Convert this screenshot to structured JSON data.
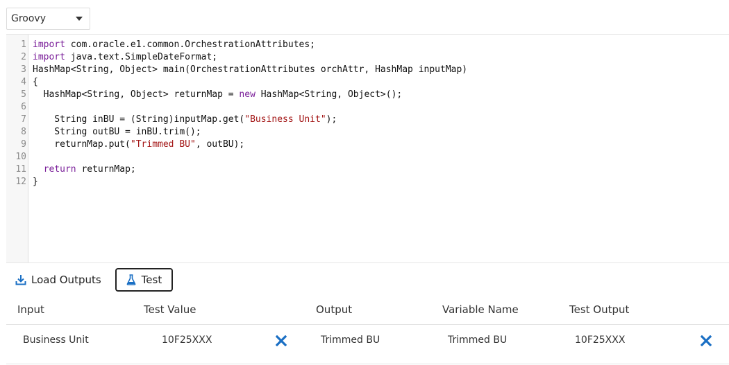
{
  "language": {
    "selected": "Groovy"
  },
  "editor": {
    "lines": [
      {
        "n": "1",
        "parts": [
          {
            "t": "import",
            "c": "kw"
          },
          {
            "t": " com.oracle.e1.common.OrchestrationAttributes;"
          }
        ]
      },
      {
        "n": "2",
        "parts": [
          {
            "t": "import",
            "c": "kw"
          },
          {
            "t": " java.text.SimpleDateFormat;"
          }
        ]
      },
      {
        "n": "3",
        "parts": [
          {
            "t": "HashMap<String, Object> main(OrchestrationAttributes orchAttr, HashMap inputMap)"
          }
        ]
      },
      {
        "n": "4",
        "parts": [
          {
            "t": "{"
          }
        ]
      },
      {
        "n": "5",
        "parts": [
          {
            "t": "  HashMap<String, Object> returnMap = "
          },
          {
            "t": "new",
            "c": "kw"
          },
          {
            "t": " HashMap<String, Object>();"
          }
        ]
      },
      {
        "n": "6",
        "parts": [
          {
            "t": ""
          }
        ]
      },
      {
        "n": "7",
        "parts": [
          {
            "t": "    String inBU = (String)inputMap.get("
          },
          {
            "t": "\"Business Unit\"",
            "c": "str"
          },
          {
            "t": ");"
          }
        ]
      },
      {
        "n": "8",
        "parts": [
          {
            "t": "    String outBU = inBU.trim();"
          }
        ]
      },
      {
        "n": "9",
        "parts": [
          {
            "t": "    returnMap.put("
          },
          {
            "t": "\"Trimmed BU\"",
            "c": "str"
          },
          {
            "t": ", outBU);"
          }
        ]
      },
      {
        "n": "10",
        "parts": [
          {
            "t": ""
          }
        ]
      },
      {
        "n": "11",
        "parts": [
          {
            "t": "  "
          },
          {
            "t": "return",
            "c": "kw"
          },
          {
            "t": " returnMap;"
          }
        ]
      },
      {
        "n": "12",
        "parts": [
          {
            "t": "}"
          }
        ]
      }
    ]
  },
  "actions": {
    "load_outputs_label": "Load Outputs",
    "test_label": "Test"
  },
  "table": {
    "headers": {
      "input": "Input",
      "test_value": "Test Value",
      "output": "Output",
      "variable_name": "Variable Name",
      "test_output": "Test Output"
    },
    "rows": [
      {
        "input": "Business Unit",
        "test_value": "10F25XXX",
        "output": "Trimmed BU",
        "variable_name": "Trimmed BU",
        "test_output": "10F25XXX"
      }
    ]
  },
  "colors": {
    "accent": "#1a6fc4",
    "keyword": "#7a1e99",
    "string": "#a31515"
  },
  "icons": {
    "load": "download-icon",
    "test": "flask-icon",
    "remove": "close-x-icon"
  }
}
